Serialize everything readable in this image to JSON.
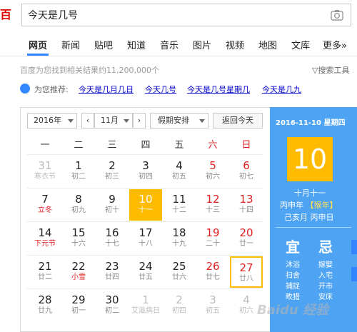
{
  "search": {
    "query": "今天是几号"
  },
  "nav": {
    "tabs": [
      "网页",
      "新闻",
      "贴吧",
      "知道",
      "音乐",
      "图片",
      "视频",
      "地图",
      "文库",
      "更多»"
    ]
  },
  "results": {
    "count_text": "百度为您找到相关结果约11,200,000个",
    "tools": "搜索工具"
  },
  "recommend": {
    "label": "为您推荐:",
    "links": [
      "今天是几月几日",
      "今天几号",
      "今天是几号星期几",
      "今天是几九"
    ]
  },
  "calendar": {
    "year": "2016年",
    "month": "11月",
    "holiday_select": "假期安排",
    "today_button": "返回今天",
    "weekdays": [
      "一",
      "二",
      "三",
      "四",
      "五",
      "六",
      "日"
    ],
    "weeks": [
      [
        {
          "d": "31",
          "l": "寒衣节",
          "other": true
        },
        {
          "d": "1",
          "l": "初二"
        },
        {
          "d": "2",
          "l": "初三"
        },
        {
          "d": "3",
          "l": "初四"
        },
        {
          "d": "4",
          "l": "初五"
        },
        {
          "d": "5",
          "l": "初六",
          "we": true
        },
        {
          "d": "6",
          "l": "初七",
          "we": true
        }
      ],
      [
        {
          "d": "7",
          "l": "立冬",
          "fest": true
        },
        {
          "d": "8",
          "l": "初九"
        },
        {
          "d": "9",
          "l": "初十"
        },
        {
          "d": "10",
          "l": "十一",
          "today": true
        },
        {
          "d": "11",
          "l": "十二"
        },
        {
          "d": "12",
          "l": "十三",
          "we": true
        },
        {
          "d": "13",
          "l": "十四",
          "we": true
        }
      ],
      [
        {
          "d": "14",
          "l": "下元节",
          "fest": true
        },
        {
          "d": "15",
          "l": "十六"
        },
        {
          "d": "16",
          "l": "十七"
        },
        {
          "d": "17",
          "l": "十八"
        },
        {
          "d": "18",
          "l": "十九"
        },
        {
          "d": "19",
          "l": "二十",
          "we": true
        },
        {
          "d": "20",
          "l": "廿一",
          "we": true
        }
      ],
      [
        {
          "d": "21",
          "l": "廿二"
        },
        {
          "d": "22",
          "l": "小雪",
          "fest": true
        },
        {
          "d": "23",
          "l": "廿四"
        },
        {
          "d": "24",
          "l": "廿五"
        },
        {
          "d": "25",
          "l": "廿六"
        },
        {
          "d": "26",
          "l": "廿七",
          "we": true
        },
        {
          "d": "27",
          "l": "廿八",
          "we": true,
          "marked": true
        }
      ],
      [
        {
          "d": "28",
          "l": "廿九"
        },
        {
          "d": "29",
          "l": "初一"
        },
        {
          "d": "30",
          "l": "初二"
        },
        {
          "d": "1",
          "l": "艾滋病日",
          "other": true
        },
        {
          "d": "2",
          "l": "初四",
          "other": true
        },
        {
          "d": "3",
          "l": "初五",
          "other": true
        },
        {
          "d": "4",
          "l": "初六",
          "other": true
        }
      ]
    ]
  },
  "panel": {
    "date": "2016-11-10 星期四",
    "day": "10",
    "lunar": "十月十一",
    "ganzhi_year": "丙申年",
    "zodiac": "【猴年】",
    "ganzhi_day": "己亥月 丙申日",
    "yi": "宜",
    "ji": "忌",
    "yi_items": [
      "沐浴",
      "扫舍",
      "捕捉",
      "畋猎"
    ],
    "ji_items": [
      "嫁娶",
      "入宅",
      "开市",
      "安床"
    ]
  },
  "watermark": "Baidu 经验"
}
